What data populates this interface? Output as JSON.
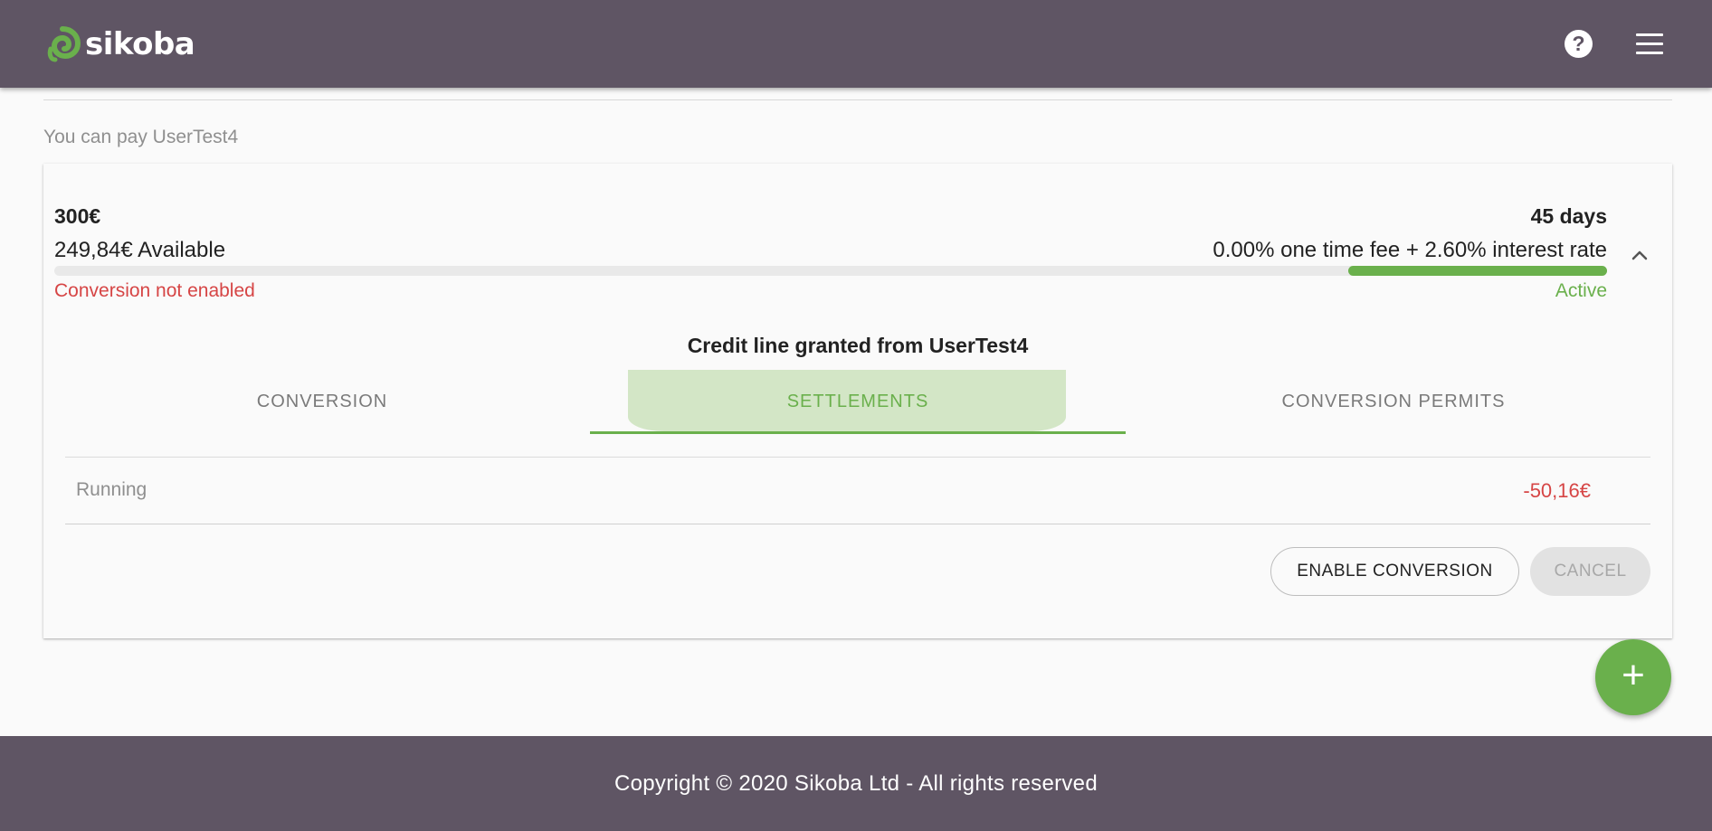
{
  "header": {
    "brand": "sikoba",
    "help_icon_glyph": "?",
    "icons": [
      "spiral-logo-icon",
      "help-icon",
      "menu-icon"
    ]
  },
  "colors": {
    "header_bg": "#5f5564",
    "accent_green": "#6ab04c",
    "error_red": "#d64545",
    "tab_selected_bg": "#d3e6c6"
  },
  "main": {
    "pay_label": "You can pay UserTest4"
  },
  "credit_line": {
    "amount": "300€",
    "duration": "45 days",
    "available": "249,84€ Available",
    "fee_text": "0.00% one time fee + 2.60% interest rate",
    "progress_fraction": 0.1667,
    "conversion_status": "Conversion not enabled",
    "status": "Active",
    "title": "Credit line granted from UserTest4",
    "tabs": [
      {
        "label": "CONVERSION",
        "selected": false
      },
      {
        "label": "SETTLEMENTS",
        "selected": true
      },
      {
        "label": "CONVERSION PERMITS",
        "selected": false
      }
    ],
    "settlement": {
      "label": "Running",
      "value": "-50,16€"
    },
    "actions": {
      "enable_conversion": "ENABLE CONVERSION",
      "cancel": "CANCEL"
    }
  },
  "fab": {
    "glyph": "+",
    "icon": "plus-icon"
  },
  "footer": {
    "copyright": "Copyright © 2020 Sikoba Ltd - All rights reserved"
  }
}
